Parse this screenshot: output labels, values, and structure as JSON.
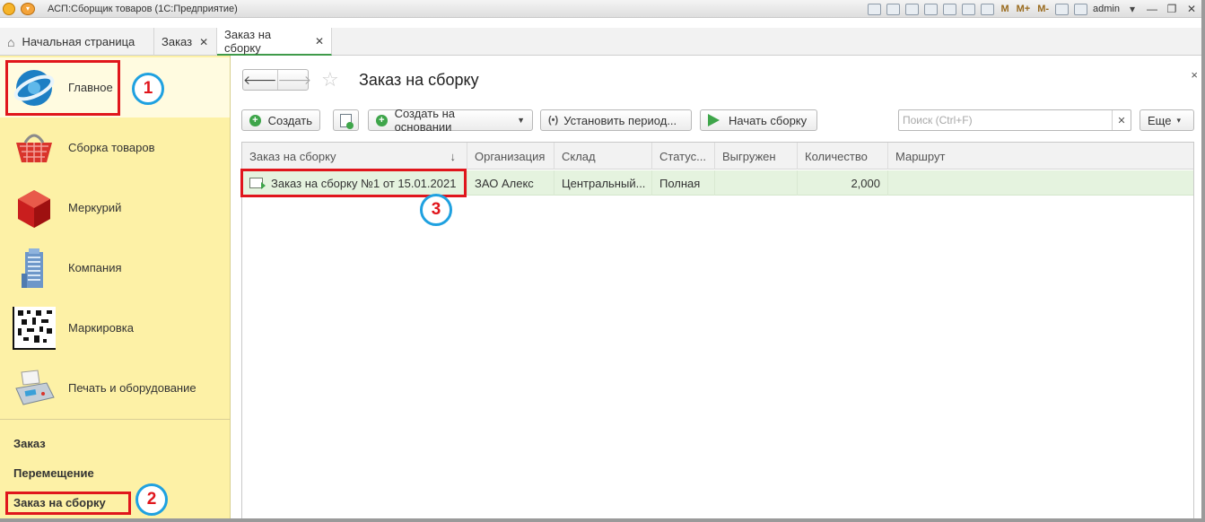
{
  "window": {
    "title": "АСП:Сборщик товаров  (1С:Предприятие)",
    "user": "admin",
    "quick_tools": [
      "M",
      "M+",
      "M-"
    ]
  },
  "tabs": [
    {
      "label": "Начальная страница",
      "closable": false
    },
    {
      "label": "Заказ",
      "closable": true
    },
    {
      "label": "Заказ на сборку",
      "closable": true,
      "active": true
    }
  ],
  "sidebar": {
    "sections": [
      {
        "label": "Главное",
        "icon": "main-logo-icon",
        "active": true
      },
      {
        "label": "Сборка товаров",
        "icon": "basket-icon"
      },
      {
        "label": "Меркурий",
        "icon": "red-cube-icon"
      },
      {
        "label": "Компания",
        "icon": "building-icon"
      },
      {
        "label": "Маркировка",
        "icon": "datamatrix-icon"
      },
      {
        "label": "Печать и оборудование",
        "icon": "cash-register-icon"
      }
    ],
    "links": [
      "Заказ",
      "Перемещение",
      "Заказ на сборку"
    ]
  },
  "annotations": [
    "1",
    "2",
    "3"
  ],
  "main": {
    "title": "Заказ на сборку",
    "toolbar": {
      "create": "Создать",
      "create_based": "Создать на основании",
      "set_period": "Установить период...",
      "start_assembly": "Начать сборку",
      "more": "Еще"
    },
    "search": {
      "placeholder": "Поиск (Ctrl+F)",
      "value": ""
    },
    "table": {
      "columns": [
        "Заказ на сборку",
        "Организация",
        "Склад",
        "Статус...",
        "Выгружен",
        "Количество",
        "Маршрут"
      ],
      "rows": [
        {
          "order": "Заказ на сборку №1 от 15.01.2021",
          "organization": "ЗАО Алекс",
          "warehouse": "Центральный...",
          "status": "Полная",
          "unloaded": "",
          "quantity": "2,000",
          "route": ""
        }
      ]
    }
  },
  "colors": {
    "sidebar_bg": "#fdf1a6",
    "accent_green": "#3ea54a",
    "selected_row": "#e5f3df",
    "annotation_red": "#e0161c",
    "annotation_blue": "#1fa1e0"
  }
}
